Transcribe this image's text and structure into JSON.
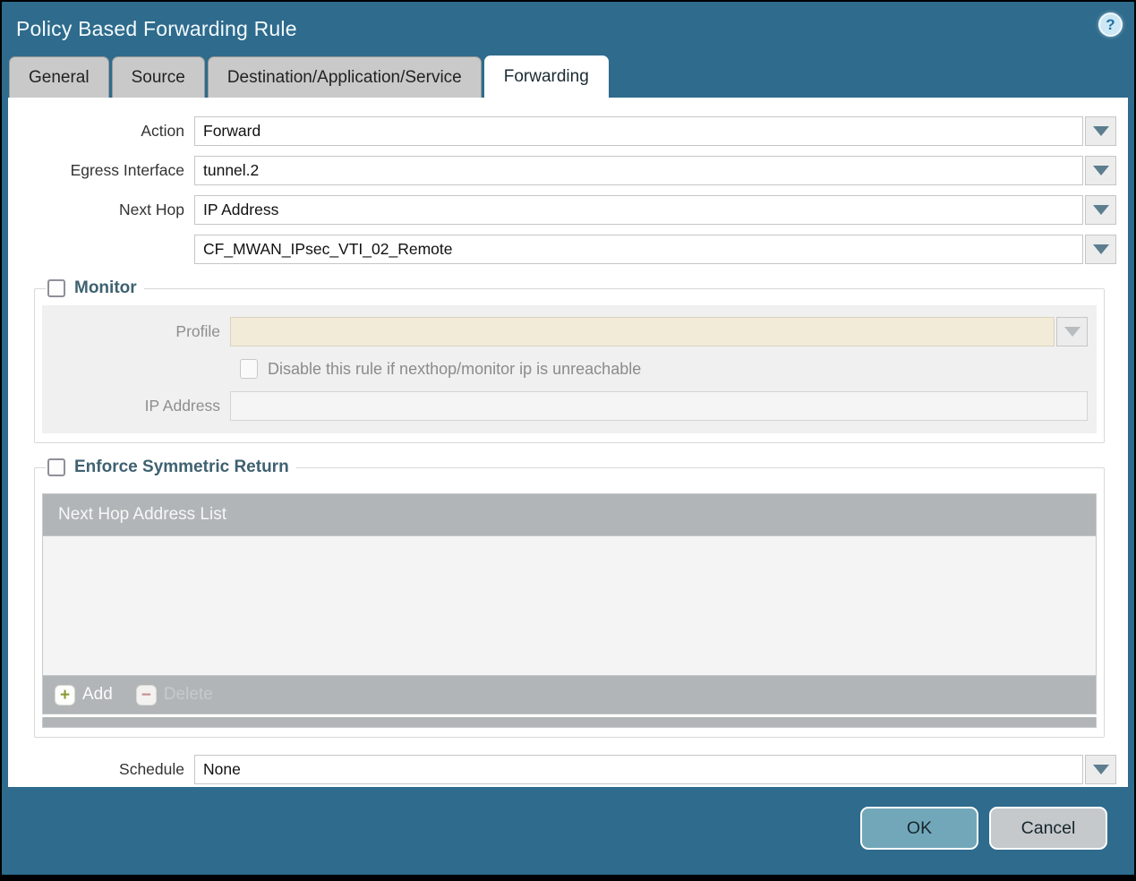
{
  "window": {
    "title": "Policy Based Forwarding Rule",
    "help_glyph": "?"
  },
  "tabs": [
    {
      "label": "General",
      "active": false
    },
    {
      "label": "Source",
      "active": false
    },
    {
      "label": "Destination/Application/Service",
      "active": false
    },
    {
      "label": "Forwarding",
      "active": true
    }
  ],
  "fields": {
    "action": {
      "label": "Action",
      "value": "Forward"
    },
    "egress_interface": {
      "label": "Egress Interface",
      "value": "tunnel.2"
    },
    "next_hop": {
      "label": "Next Hop",
      "value": "IP Address"
    },
    "next_hop_address": {
      "value": "CF_MWAN_IPsec_VTI_02_Remote"
    },
    "schedule": {
      "label": "Schedule",
      "value": "None"
    }
  },
  "monitor": {
    "legend": "Monitor",
    "checked": false,
    "profile": {
      "label": "Profile",
      "value": ""
    },
    "disable_rule_checkbox": {
      "label": "Disable this rule if nexthop/monitor ip is unreachable",
      "checked": false
    },
    "ip_address": {
      "label": "IP Address",
      "value": ""
    }
  },
  "symmetric_return": {
    "legend": "Enforce Symmetric Return",
    "checked": false,
    "table": {
      "header": "Next Hop Address List",
      "rows": []
    },
    "add_label": "Add",
    "delete_label": "Delete",
    "add_glyph": "+",
    "delete_glyph": "−"
  },
  "footer": {
    "ok_label": "OK",
    "cancel_label": "Cancel"
  },
  "colors": {
    "titlebar_background": "#2e6b8c",
    "active_tab_background": "#ffffff",
    "inactive_tab_background": "#c9c9c9",
    "table_header_gray": "#b1b5b7",
    "disabled_cream_field": "#f1ebd8",
    "group_title_text": "#3e6170",
    "ok_button": "#72a7ba",
    "cancel_button": "#c6c9cb",
    "add_icon_green": "#8a9b33",
    "delete_icon_red": "#c58e8e"
  }
}
